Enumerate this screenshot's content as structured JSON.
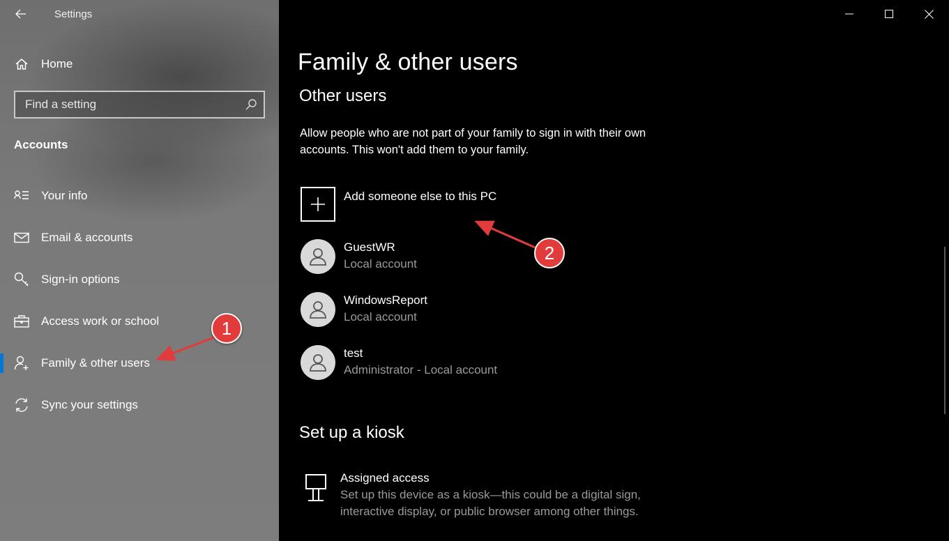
{
  "window": {
    "app_title": "Settings",
    "controls": [
      "minimize-icon",
      "maximize-icon",
      "close-icon"
    ]
  },
  "sidebar": {
    "home_label": "Home",
    "search_placeholder": "Find a setting",
    "section_title": "Accounts",
    "items": [
      {
        "label": "Your info",
        "icon": "person-list-icon"
      },
      {
        "label": "Email & accounts",
        "icon": "mail-icon"
      },
      {
        "label": "Sign-in options",
        "icon": "key-icon"
      },
      {
        "label": "Access work or school",
        "icon": "briefcase-icon"
      },
      {
        "label": "Family & other users",
        "icon": "person-add-icon",
        "selected": true
      },
      {
        "label": "Sync your settings",
        "icon": "sync-icon"
      }
    ],
    "accent_color": "#0078d7"
  },
  "main": {
    "title": "Family & other users",
    "other_users": {
      "heading": "Other users",
      "description": "Allow people who are not part of your family to sign in with their own accounts. This won't add them to your family.",
      "add_label": "Add someone else to this PC",
      "users": [
        {
          "name": "GuestWR",
          "type": "Local account"
        },
        {
          "name": "WindowsReport",
          "type": "Local account"
        },
        {
          "name": "test",
          "type": "Administrator - Local account"
        }
      ]
    },
    "kiosk": {
      "heading": "Set up a kiosk",
      "title": "Assigned access",
      "description": "Set up this device as a kiosk—this could be a digital sign, interactive display, or public browser among other things."
    }
  },
  "annotations": {
    "badge_1": "1",
    "badge_2": "2",
    "color": "#e23b3b"
  }
}
